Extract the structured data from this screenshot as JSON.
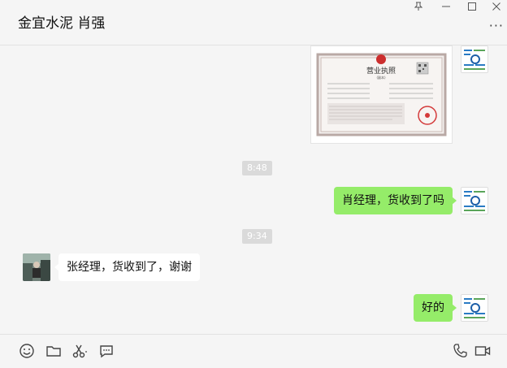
{
  "header": {
    "title": "金宜水泥 肖强",
    "window_controls": [
      "pin-icon",
      "minimize-icon",
      "maximize-icon",
      "close-icon"
    ],
    "more_label": "···"
  },
  "messages": [
    {
      "type": "image",
      "sender": "me",
      "image_text": {
        "title": "营业执照",
        "subtitle": "(副本)"
      }
    },
    {
      "type": "time",
      "text": "8:48"
    },
    {
      "type": "text",
      "sender": "me",
      "text": "肖经理，货收到了吗"
    },
    {
      "type": "time",
      "text": "9:34"
    },
    {
      "type": "text",
      "sender": "them",
      "text": "张经理，货收到了，谢谢"
    },
    {
      "type": "text",
      "sender": "me",
      "text": "好的"
    }
  ],
  "toolbar": {
    "left": [
      "emoji-icon",
      "folder-icon",
      "scissors-icon",
      "chat-history-icon"
    ],
    "right": [
      "phone-icon",
      "video-icon"
    ]
  },
  "colors": {
    "background": "#f5f5f5",
    "my_bubble": "#95ec69",
    "their_bubble": "#ffffff",
    "time_pill": "#dadada"
  }
}
